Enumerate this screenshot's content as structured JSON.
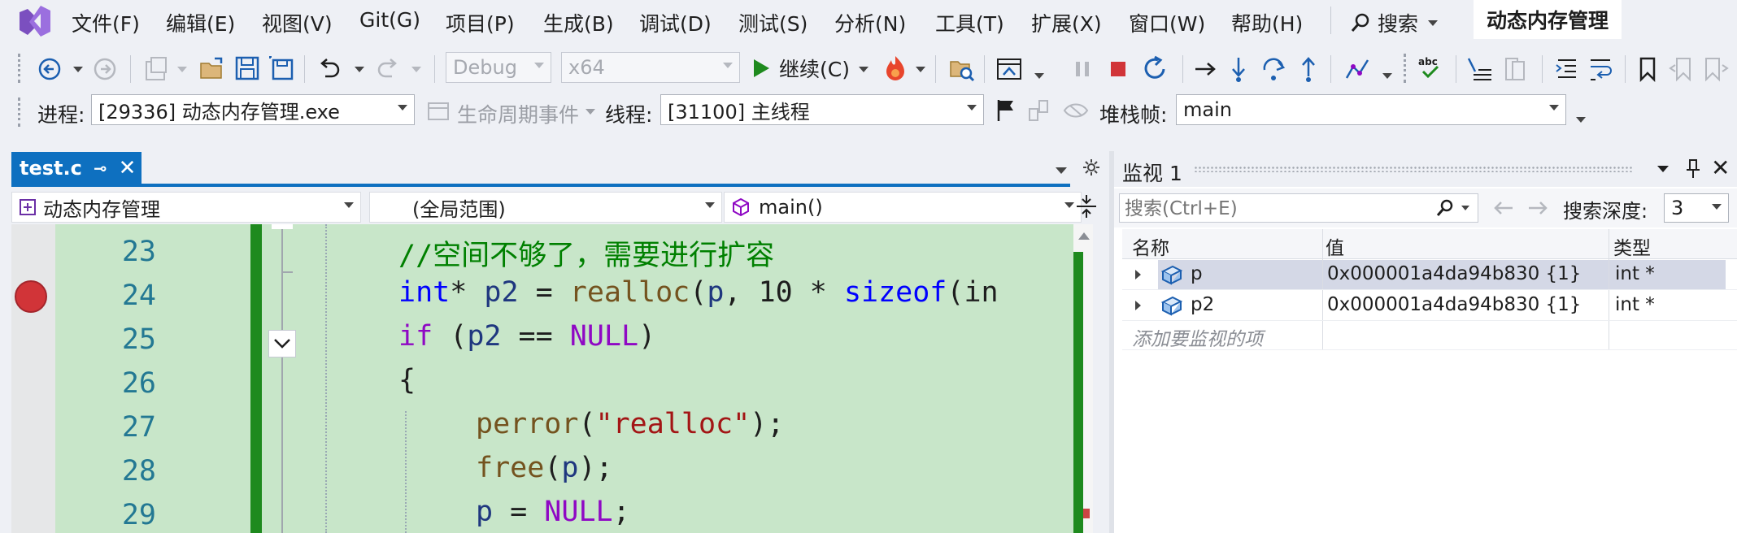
{
  "menu": {
    "items": [
      "文件(F)",
      "编辑(E)",
      "视图(V)",
      "Git(G)",
      "项目(P)",
      "生成(B)",
      "调试(D)",
      "测试(S)",
      "分析(N)",
      "工具(T)",
      "扩展(X)",
      "窗口(W)",
      "帮助(H)"
    ],
    "search_label": "搜索",
    "solution_title": "动态内存管理"
  },
  "toolbar1": {
    "config": "Debug",
    "platform": "x64",
    "continue_label": "继续(C)"
  },
  "toolbar2": {
    "process_label": "进程:",
    "process_value": "[29336] 动态内存管理.exe",
    "lifecycle_label": "生命周期事件",
    "thread_label": "线程:",
    "thread_value": "[31100] 主线程",
    "stack_label": "堆栈帧:",
    "stack_value": "main"
  },
  "editor": {
    "tab_name": "test.c",
    "nav_project": "动态内存管理",
    "nav_scope": "(全局范围)",
    "nav_function": "main()",
    "lines": [
      {
        "num": "23"
      },
      {
        "num": "24"
      },
      {
        "num": "25"
      },
      {
        "num": "26"
      },
      {
        "num": "27"
      },
      {
        "num": "28"
      },
      {
        "num": "29"
      }
    ],
    "code": {
      "l23": "//空间不够了，需要进行扩容",
      "l24_type": "int",
      "l24_a": "* ",
      "l24_var": "p2",
      "l24_b": " = ",
      "l24_fn": "realloc",
      "l24_c": "(",
      "l24_p": "p",
      "l24_d": ", 10 * ",
      "l24_sizeof": "sizeof",
      "l24_e": "(in",
      "l25_if": "if",
      "l25_a": " (",
      "l25_var": "p2",
      "l25_b": " == ",
      "l25_null": "NULL",
      "l25_c": ")",
      "l26": "{",
      "l27_fn": "perror",
      "l27_a": "(",
      "l27_str": "\"realloc\"",
      "l27_b": ");",
      "l28_fn": "free",
      "l28_a": "(",
      "l28_p": "p",
      "l28_b": ");",
      "l29_p": "p",
      "l29_a": " = ",
      "l29_null": "NULL",
      "l29_b": ";"
    }
  },
  "watch": {
    "title": "监视 1",
    "search_placeholder": "搜索(Ctrl+E)",
    "depth_label": "搜索深度:",
    "depth_value": "3",
    "columns": {
      "name": "名称",
      "value": "值",
      "type": "类型"
    },
    "rows": [
      {
        "name": "p",
        "value": "0x000001a4da94b830 {1}",
        "type": "int *"
      },
      {
        "name": "p2",
        "value": "0x000001a4da94b830 {1}",
        "type": "int *"
      }
    ],
    "add_item": "添加要监视的项"
  },
  "colors": {
    "accent": "#0e70c0",
    "breakpoint": "#d13438",
    "changes_bar": "#1e8a1e",
    "code_highlight": "#c8e6c9"
  }
}
